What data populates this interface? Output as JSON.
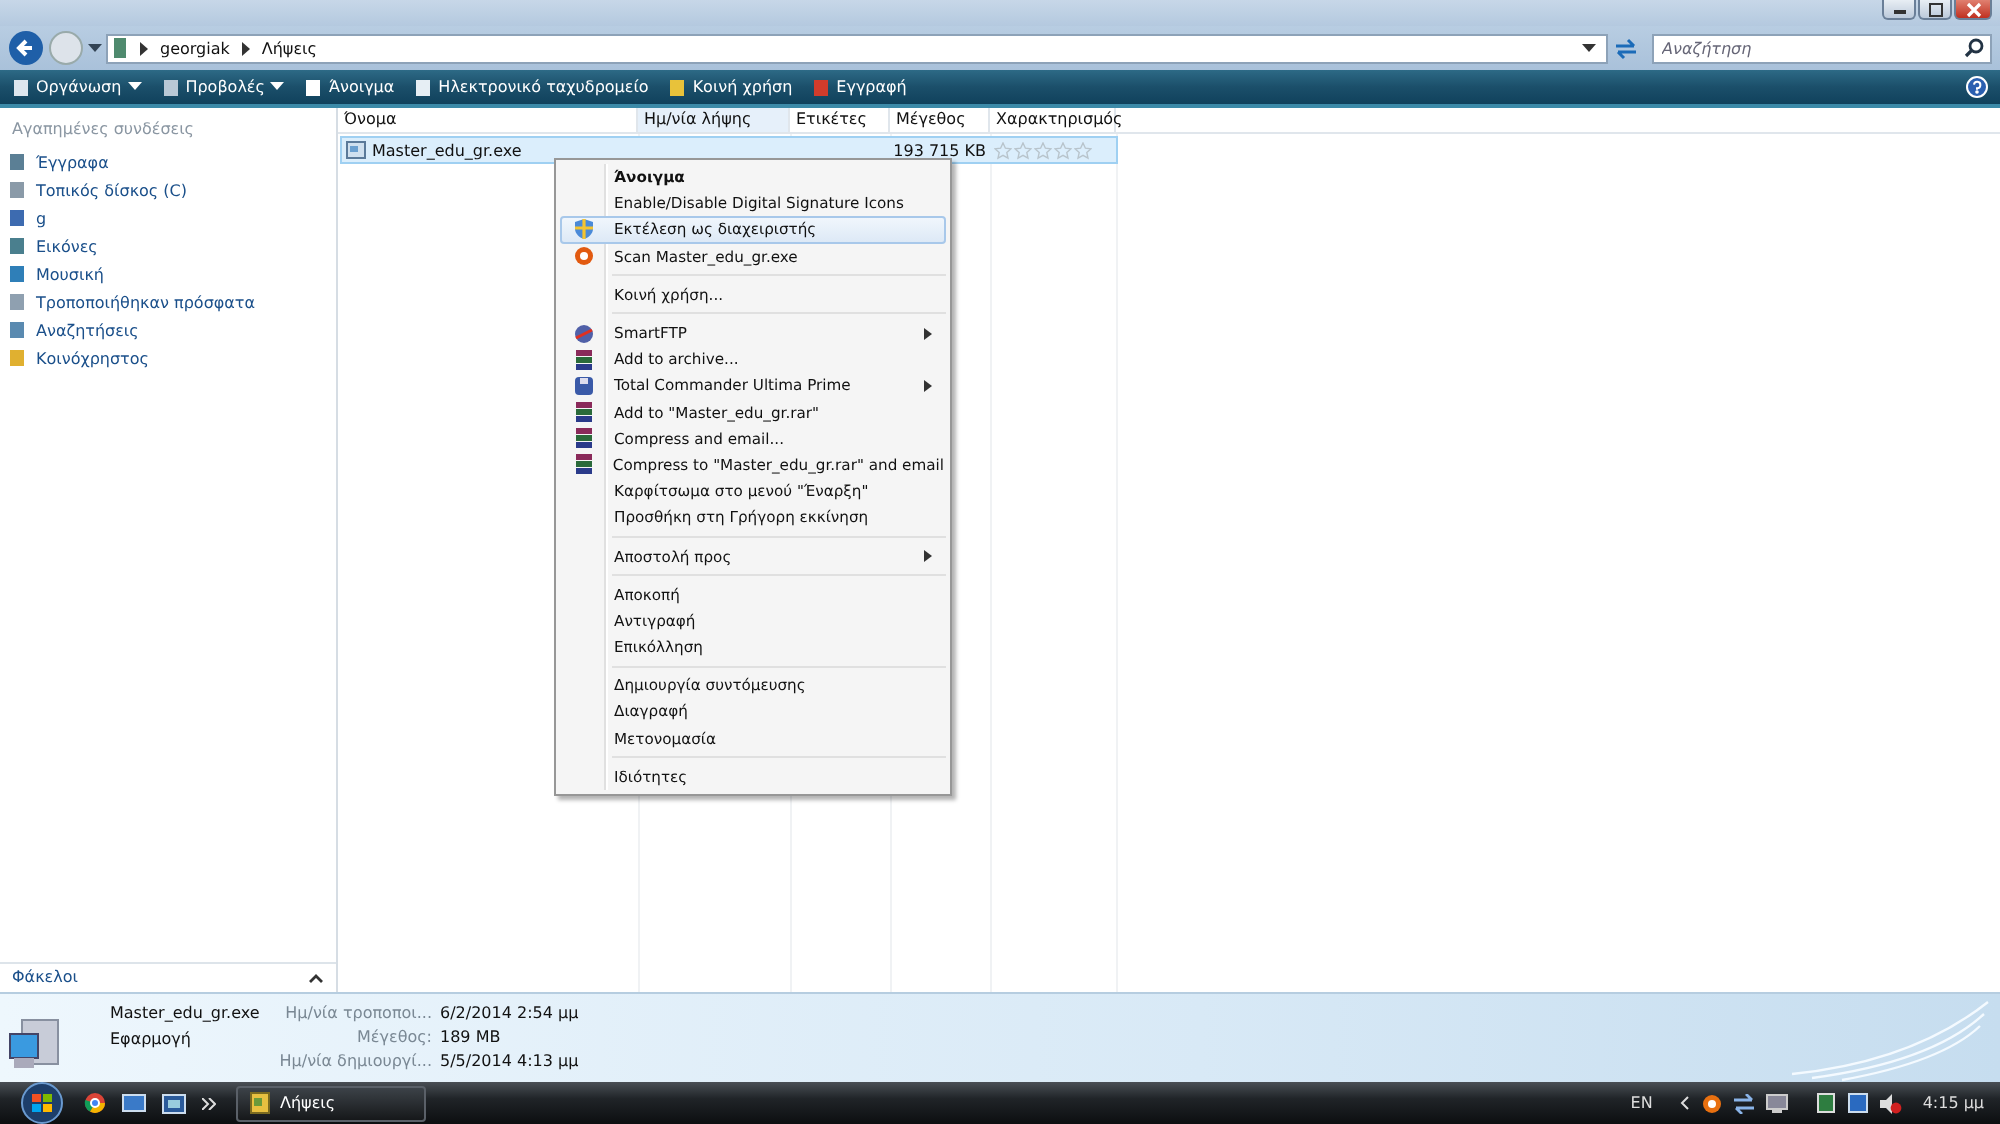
{
  "address": {
    "path": [
      "georgiak",
      "Λήψεις"
    ],
    "search_placeholder": "Αναζήτηση"
  },
  "toolbar": [
    {
      "label": "Οργάνωση",
      "dropdown": true
    },
    {
      "label": "Προβολές",
      "dropdown": true
    },
    {
      "label": "Άνοιγμα",
      "dropdown": false
    },
    {
      "label": "Ηλεκτρονικό ταχυδρομείο",
      "dropdown": false
    },
    {
      "label": "Κοινή χρήση",
      "dropdown": false
    },
    {
      "label": "Εγγραφή",
      "dropdown": false
    }
  ],
  "sidebar": {
    "heading": "Αγαπημένες συνδέσεις",
    "items": [
      "Έγγραφα",
      "Τοπικός δίσκος (C)",
      "g",
      "Εικόνες",
      "Μουσική",
      "Τροποποιήθηκαν πρόσφατα",
      "Αναζητήσεις",
      "Κοινόχρηστος"
    ],
    "folders_label": "Φάκελοι"
  },
  "table": {
    "columns": [
      {
        "label": "Όνομα",
        "sorted": false
      },
      {
        "label": "Ημ/νία λήψης",
        "sorted": true
      },
      {
        "label": "Ετικέτες",
        "sorted": false
      },
      {
        "label": "Μέγεθος",
        "sorted": false
      },
      {
        "label": "Χαρακτηρισμός",
        "sorted": false
      }
    ],
    "rows": [
      {
        "name": "Master_edu_gr.exe",
        "size": "193 715 KB",
        "stars": 0,
        "selected": true
      }
    ]
  },
  "context_menu": [
    {
      "kind": "plain",
      "label": "Άνοιγμα",
      "default": true,
      "selected": false,
      "submenu": false
    },
    {
      "kind": "plain",
      "label": "Enable/Disable Digital Signature Icons",
      "default": false,
      "selected": false,
      "submenu": false
    },
    {
      "kind": "shield",
      "label": "Εκτέλεση ως διαχειριστής",
      "default": false,
      "selected": true,
      "submenu": false
    },
    {
      "kind": "scan",
      "label": "Scan Master_edu_gr.exe",
      "default": false,
      "selected": false,
      "submenu": false
    },
    {
      "kind": "separator"
    },
    {
      "kind": "plain",
      "label": "Κοινή χρήση...",
      "default": false,
      "selected": false,
      "submenu": false
    },
    {
      "kind": "separator"
    },
    {
      "kind": "globe",
      "label": "SmartFTP",
      "default": false,
      "selected": false,
      "submenu": true
    },
    {
      "kind": "archive",
      "label": "Add to archive...",
      "default": false,
      "selected": false,
      "submenu": false
    },
    {
      "kind": "disk",
      "label": "Total Commander Ultima Prime",
      "default": false,
      "selected": false,
      "submenu": true
    },
    {
      "kind": "archive",
      "label": "Add to \"Master_edu_gr.rar\"",
      "default": false,
      "selected": false,
      "submenu": false
    },
    {
      "kind": "archive",
      "label": "Compress and email...",
      "default": false,
      "selected": false,
      "submenu": false
    },
    {
      "kind": "archive",
      "label": "Compress to \"Master_edu_gr.rar\" and email",
      "default": false,
      "selected": false,
      "submenu": false
    },
    {
      "kind": "plain",
      "label": "Καρφίτσωμα στο μενού \"Έναρξη\"",
      "default": false,
      "selected": false,
      "submenu": false
    },
    {
      "kind": "plain",
      "label": "Προσθήκη στη Γρήγορη εκκίνηση",
      "default": false,
      "selected": false,
      "submenu": false
    },
    {
      "kind": "separator"
    },
    {
      "kind": "plain",
      "label": "Αποστολή προς",
      "default": false,
      "selected": false,
      "submenu": true
    },
    {
      "kind": "separator"
    },
    {
      "kind": "plain",
      "label": "Αποκοπή",
      "default": false,
      "selected": false,
      "submenu": false
    },
    {
      "kind": "plain",
      "label": "Αντιγραφή",
      "default": false,
      "selected": false,
      "submenu": false
    },
    {
      "kind": "plain",
      "label": "Επικόλληση",
      "default": false,
      "selected": false,
      "submenu": false
    },
    {
      "kind": "separator"
    },
    {
      "kind": "plain",
      "label": "Δημιουργία συντόμευσης",
      "default": false,
      "selected": false,
      "submenu": false
    },
    {
      "kind": "plain",
      "label": "Διαγραφή",
      "default": false,
      "selected": false,
      "submenu": false
    },
    {
      "kind": "plain",
      "label": "Μετονομασία",
      "default": false,
      "selected": false,
      "submenu": false
    },
    {
      "kind": "separator"
    },
    {
      "kind": "plain",
      "label": "Ιδιότητες",
      "default": false,
      "selected": false,
      "submenu": false
    }
  ],
  "details": {
    "name": "Master_edu_gr.exe",
    "type": "Εφαρμογή",
    "fields": [
      {
        "label": "Ημ/νία τροποποι...",
        "value": "6/2/2014 2:54 μμ"
      },
      {
        "label": "Μέγεθος:",
        "value": "189 MB"
      },
      {
        "label": "Ημ/νία δημιουργί...",
        "value": "5/5/2014 4:13 μμ"
      }
    ]
  },
  "taskbar": {
    "window": "Λήψεις",
    "language": "EN",
    "clock": "4:15 μμ"
  }
}
